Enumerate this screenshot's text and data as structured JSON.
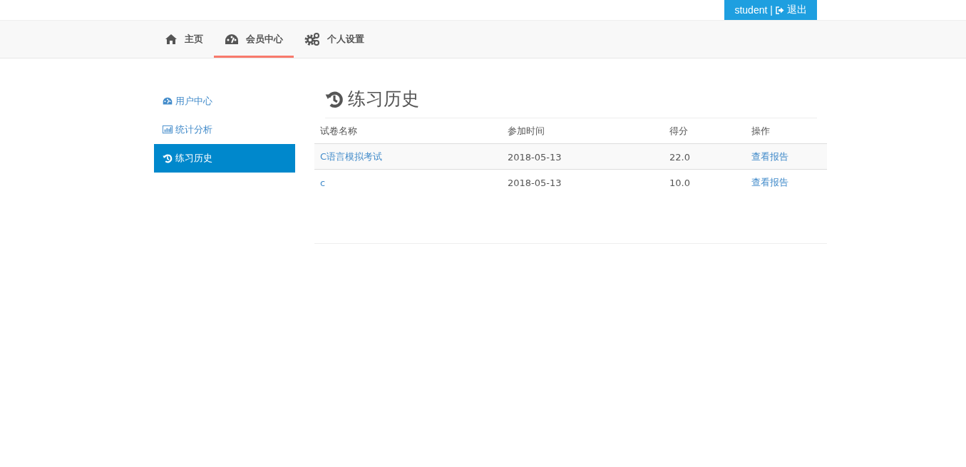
{
  "user_bar": {
    "username": "student",
    "separator": "|",
    "logout": "退出"
  },
  "nav": [
    {
      "label": "主页",
      "selected": false
    },
    {
      "label": "会员中心",
      "selected": true
    },
    {
      "label": "个人设置",
      "selected": false
    }
  ],
  "sidebar": {
    "items": [
      {
        "label": "用户中心",
        "selected": false
      },
      {
        "label": "统计分析",
        "selected": false
      },
      {
        "label": "练习历史",
        "selected": true
      }
    ]
  },
  "heading": "练习历史",
  "table": {
    "columns": [
      "试卷名称",
      "参加时间",
      "得分",
      "操作"
    ],
    "rows": [
      {
        "name": "C语言模拟考试",
        "date": "2018-05-13",
        "score": "22.0",
        "action": "查看报告"
      },
      {
        "name": "c",
        "date": "2018-05-13",
        "score": "10.0",
        "action": "查看报告"
      }
    ]
  }
}
